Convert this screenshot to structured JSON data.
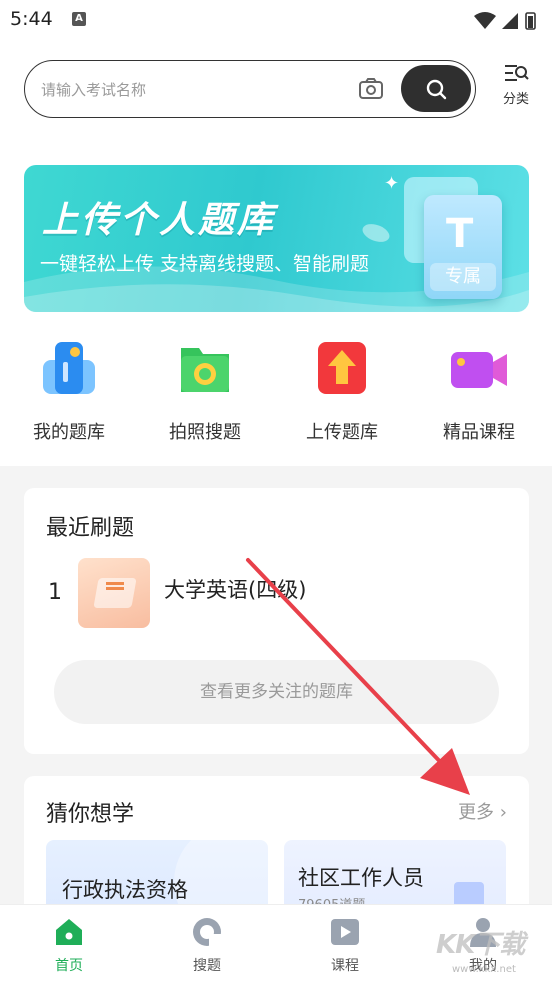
{
  "status_bar": {
    "time": "5:44"
  },
  "search": {
    "placeholder": "请输入考试名称"
  },
  "category": {
    "label": "分类"
  },
  "banner": {
    "title": "上传个人题库",
    "subtitle": "一键轻松上传  支持离线搜题、智能刷题",
    "card_letter": "T",
    "card_tag": "专属"
  },
  "quick_actions": [
    {
      "label": "我的题库",
      "icon": "phone-bank-icon"
    },
    {
      "label": "拍照搜题",
      "icon": "camera-folder-icon"
    },
    {
      "label": "上传题库",
      "icon": "upload-arrow-icon"
    },
    {
      "label": "精品课程",
      "icon": "video-camera-icon"
    }
  ],
  "recent": {
    "title": "最近刷题",
    "items": [
      {
        "rank": "1",
        "name": "大学英语(四级)"
      }
    ],
    "more_label": "查看更多关注的题库"
  },
  "guess": {
    "title": "猜你想学",
    "more_label": "更多",
    "items": [
      {
        "name": "行政执法资格",
        "count": ""
      },
      {
        "name": "社区工作人员",
        "count": "79605道题"
      }
    ]
  },
  "bottom_nav": [
    {
      "label": "首页",
      "active": true
    },
    {
      "label": "搜题",
      "active": false
    },
    {
      "label": "课程",
      "active": false
    },
    {
      "label": "我的",
      "active": false
    }
  ],
  "watermark": {
    "text": "KK下载",
    "url": "www.kkx.net"
  },
  "colors": {
    "accent_green": "#1fae58",
    "banner_teal": "#2fc9cf",
    "annotation_red": "#e8404a"
  }
}
